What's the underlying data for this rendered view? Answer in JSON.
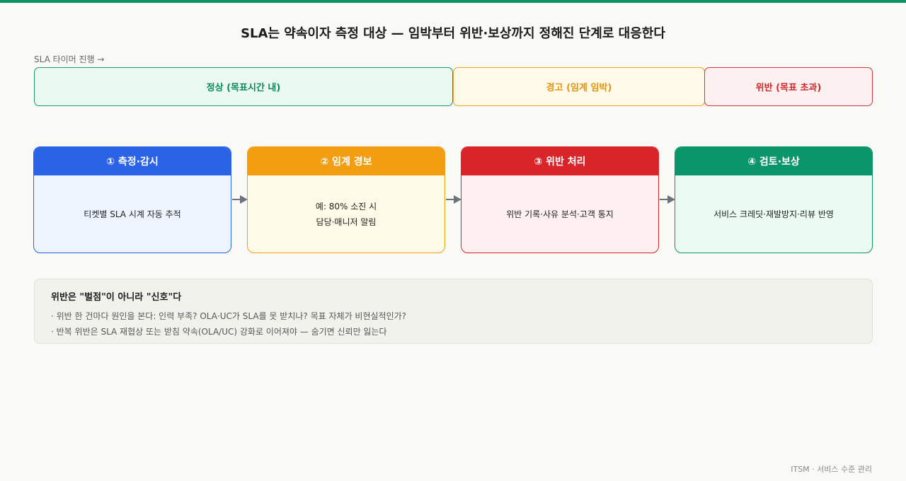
{
  "title": "SLA는 약속이자 측정 대상 — 임박부터 위반·보상까지 정해진 단계로 대응한다",
  "timer_label": "SLA 타이머 진행 →",
  "zones": {
    "normal": "정상 (목표시간 내)",
    "warning": "경고 (임계 임박)",
    "breach": "위반 (목표 초과)"
  },
  "steps": [
    {
      "title": "① 측정·감시",
      "lines": [
        "티켓별 SLA 시계 자동 추적"
      ]
    },
    {
      "title": "② 임계 경보",
      "lines": [
        "예: 80% 소진 시",
        "담당·매니저 알림"
      ]
    },
    {
      "title": "③ 위반 처리",
      "lines": [
        "위반 기록·사유 분석·고객 통지"
      ]
    },
    {
      "title": "④ 검토·보상",
      "lines": [
        "서비스 크레딧·재발방지·리뷰 반영"
      ]
    }
  ],
  "note": {
    "title": "위반은 \"벌점\"이 아니라 \"신호\"다",
    "lines": [
      "· 위반 한 건마다 원인을 본다: 인력 부족? OLA·UC가 SLA를 못 받치나? 목표 자체가 비현실적인가?",
      "· 반복 위반은 SLA 재협상 또는 받침 약속(OLA/UC) 강화로 이어져야 — 숨기면 신뢰만 잃는다"
    ]
  },
  "footer": "ITSM · 서비스 수준 관리",
  "colors": {
    "accent": "#0a9466",
    "step1": "#2a63e6",
    "step2": "#f29e10",
    "step3": "#d9252a",
    "step4": "#0a966a",
    "arrow": "#6b7280"
  }
}
